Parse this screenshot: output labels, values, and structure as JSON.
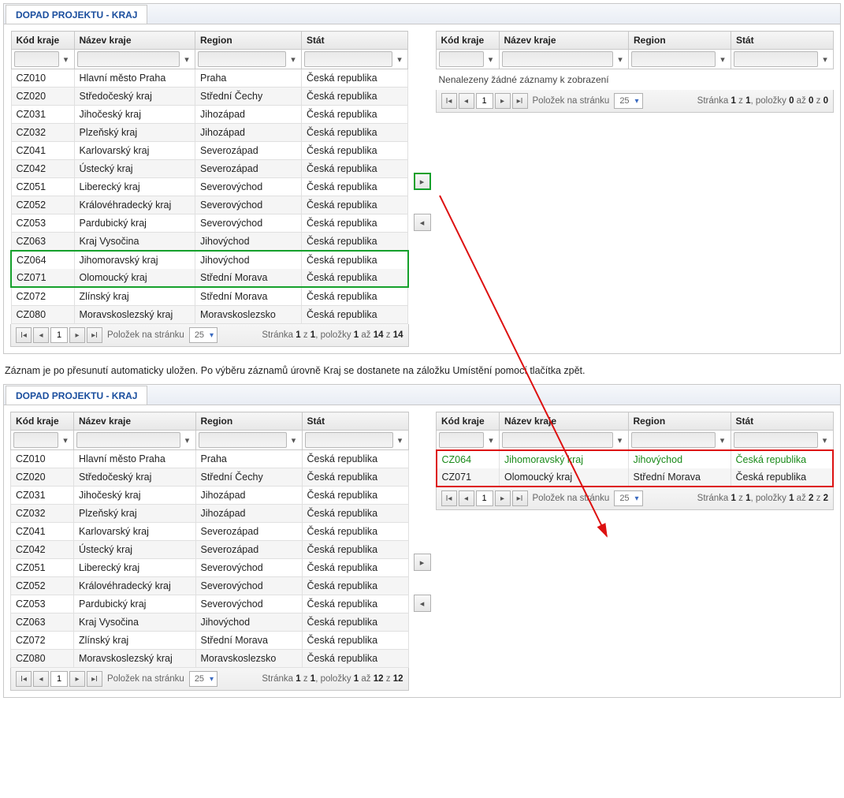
{
  "tab_title": "DOPAD PROJEKTU - KRAJ",
  "columns": {
    "code": "Kód kraje",
    "name": "Název kraje",
    "region": "Region",
    "state": "Stát"
  },
  "state_default": "Česká republika",
  "rows_top_left": [
    {
      "code": "CZ010",
      "name": "Hlavní město Praha",
      "region": "Praha"
    },
    {
      "code": "CZ020",
      "name": "Středočeský kraj",
      "region": "Střední Čechy"
    },
    {
      "code": "CZ031",
      "name": "Jihočeský kraj",
      "region": "Jihozápad"
    },
    {
      "code": "CZ032",
      "name": "Plzeňský kraj",
      "region": "Jihozápad"
    },
    {
      "code": "CZ041",
      "name": "Karlovarský kraj",
      "region": "Severozápad"
    },
    {
      "code": "CZ042",
      "name": "Ústecký kraj",
      "region": "Severozápad"
    },
    {
      "code": "CZ051",
      "name": "Liberecký kraj",
      "region": "Severovýchod"
    },
    {
      "code": "CZ052",
      "name": "Královéhradecký kraj",
      "region": "Severovýchod"
    },
    {
      "code": "CZ053",
      "name": "Pardubický kraj",
      "region": "Severovýchod"
    },
    {
      "code": "CZ063",
      "name": "Kraj Vysočina",
      "region": "Jihovýchod"
    },
    {
      "code": "CZ064",
      "name": "Jihomoravský kraj",
      "region": "Jihovýchod",
      "green": true
    },
    {
      "code": "CZ071",
      "name": "Olomoucký kraj",
      "region": "Střední Morava",
      "green": true
    },
    {
      "code": "CZ072",
      "name": "Zlínský kraj",
      "region": "Střední Morava"
    },
    {
      "code": "CZ080",
      "name": "Moravskoslezský kraj",
      "region": "Moravskoslezsko"
    }
  ],
  "top_right_empty_msg": "Nenalezeny žádné záznamy k zobrazení",
  "pager": {
    "per_page_label": "Položek na stránku",
    "per_page_value": "25",
    "page_input": "1"
  },
  "pager_status": {
    "top_left": {
      "page": "1",
      "pages": "1",
      "from": "1",
      "to": "14",
      "total": "14"
    },
    "top_right": {
      "page": "1",
      "pages": "1",
      "from": "0",
      "to": "0",
      "total": "0"
    },
    "bottom_left": {
      "page": "1",
      "pages": "1",
      "from": "1",
      "to": "12",
      "total": "12"
    },
    "bottom_right": {
      "page": "1",
      "pages": "1",
      "from": "1",
      "to": "2",
      "total": "2"
    }
  },
  "pager_static": {
    "stranka": "Stránka",
    "z": "z",
    "polozky": ", položky",
    "az": "až"
  },
  "info_text": "Záznam je po přesunutí automaticky uložen. Po výběru záznamů úrovně Kraj se dostanete na záložku Umístění pomocí tlačítka zpět.",
  "rows_bottom_left": [
    {
      "code": "CZ010",
      "name": "Hlavní město Praha",
      "region": "Praha"
    },
    {
      "code": "CZ020",
      "name": "Středočeský kraj",
      "region": "Střední Čechy"
    },
    {
      "code": "CZ031",
      "name": "Jihočeský kraj",
      "region": "Jihozápad"
    },
    {
      "code": "CZ032",
      "name": "Plzeňský kraj",
      "region": "Jihozápad"
    },
    {
      "code": "CZ041",
      "name": "Karlovarský kraj",
      "region": "Severozápad"
    },
    {
      "code": "CZ042",
      "name": "Ústecký kraj",
      "region": "Severozápad"
    },
    {
      "code": "CZ051",
      "name": "Liberecký kraj",
      "region": "Severovýchod"
    },
    {
      "code": "CZ052",
      "name": "Královéhradecký kraj",
      "region": "Severovýchod"
    },
    {
      "code": "CZ053",
      "name": "Pardubický kraj",
      "region": "Severovýchod"
    },
    {
      "code": "CZ063",
      "name": "Kraj Vysočina",
      "region": "Jihovýchod"
    },
    {
      "code": "CZ072",
      "name": "Zlínský kraj",
      "region": "Střední Morava"
    },
    {
      "code": "CZ080",
      "name": "Moravskoslezský kraj",
      "region": "Moravskoslezsko"
    }
  ],
  "rows_bottom_right": [
    {
      "code": "CZ064",
      "name": "Jihomoravský kraj",
      "region": "Jihovýchod",
      "green_text": true
    },
    {
      "code": "CZ071",
      "name": "Olomoucký kraj",
      "region": "Střední Morava"
    }
  ]
}
